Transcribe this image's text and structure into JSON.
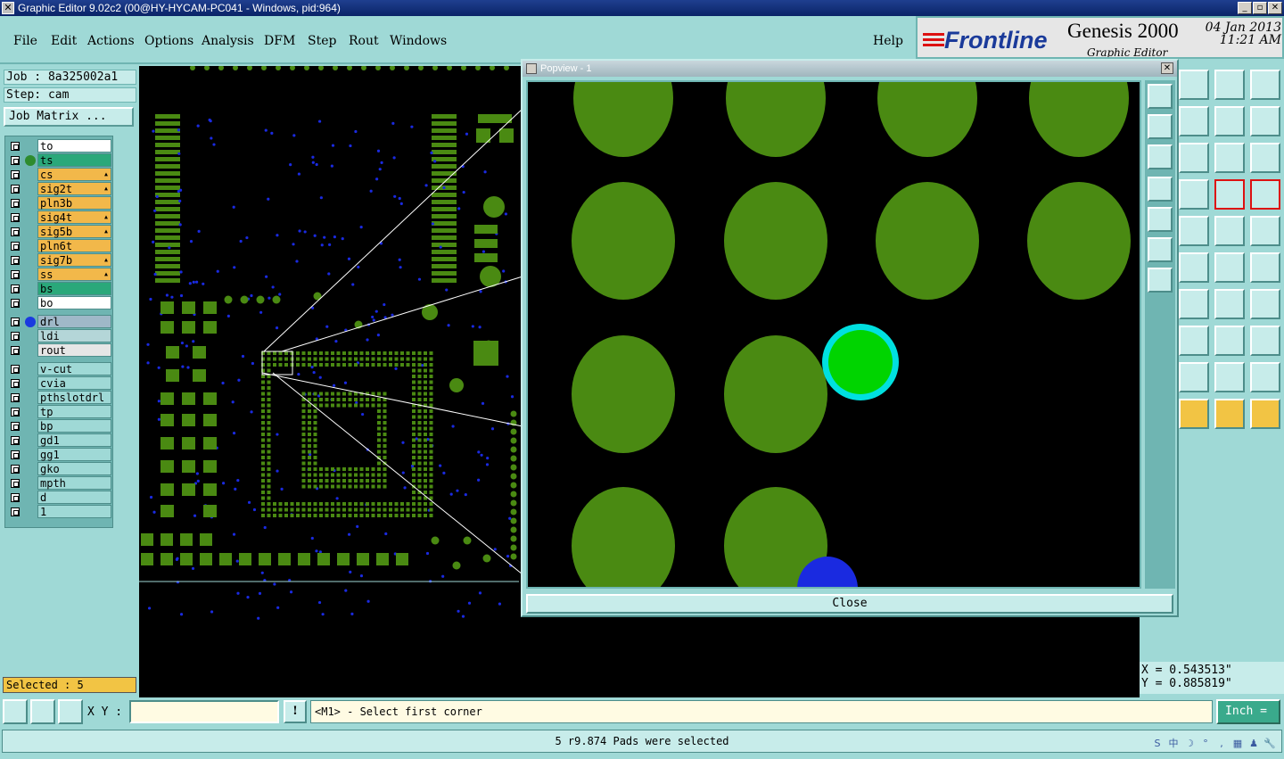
{
  "window": {
    "title": "Graphic Editor 9.02c2 (00@HY-HYCAM-PC041 - Windows, pid:964)",
    "app_icon": "x-icon",
    "controls": [
      "_",
      "▫",
      "X"
    ]
  },
  "menu": {
    "items": [
      "File",
      "Edit",
      "Actions",
      "Options",
      "Analysis",
      "DFM",
      "Step",
      "Rout",
      "Windows"
    ],
    "help": "Help"
  },
  "brand": {
    "logo": "Frontline",
    "product": "Genesis 2000",
    "subtitle": "Graphic Editor",
    "date": "04 Jan 2013",
    "time": "11:21 AM"
  },
  "job": {
    "job_line": "Job : 8a325002a1",
    "step_line": "Step: cam",
    "matrix_button": "Job Matrix ..."
  },
  "layers": {
    "board": [
      {
        "name": "to",
        "color": "#ffffff",
        "flag": ""
      },
      {
        "name": "ts",
        "color": "#2aa87a",
        "flag": "",
        "dot": "#2e8b2e"
      },
      {
        "name": "cs",
        "color": "#f2b84a",
        "flag": "▴"
      },
      {
        "name": "sig2t",
        "color": "#f2b84a",
        "flag": "▴"
      },
      {
        "name": "pln3b",
        "color": "#f2b84a",
        "flag": ""
      },
      {
        "name": "sig4t",
        "color": "#f2b84a",
        "flag": "▴"
      },
      {
        "name": "sig5b",
        "color": "#f2b84a",
        "flag": "▴"
      },
      {
        "name": "pln6t",
        "color": "#f2b84a",
        "flag": ""
      },
      {
        "name": "sig7b",
        "color": "#f2b84a",
        "flag": "▴"
      },
      {
        "name": "ss",
        "color": "#f2b84a",
        "flag": "▴"
      },
      {
        "name": "bs",
        "color": "#2aa87a",
        "flag": ""
      },
      {
        "name": "bo",
        "color": "#ffffff",
        "flag": ""
      }
    ],
    "drill": [
      {
        "name": "drl",
        "color": "#9fb8c8",
        "dot": "#1a3ae0"
      },
      {
        "name": "ldi",
        "color": "#b4d6d8"
      },
      {
        "name": "rout",
        "color": "#e6e6e6"
      }
    ],
    "misc": [
      {
        "name": "v-cut"
      },
      {
        "name": "cvia"
      },
      {
        "name": "pthslotdrl"
      },
      {
        "name": "tp"
      },
      {
        "name": "bp"
      },
      {
        "name": "gd1"
      },
      {
        "name": "gg1"
      },
      {
        "name": "gko"
      },
      {
        "name": "mpth"
      },
      {
        "name": "d"
      },
      {
        "name": "1"
      }
    ]
  },
  "selection": {
    "label": "Selected : 5"
  },
  "popview": {
    "title": "Popview - 1",
    "close_label": "Close",
    "pad_color": "#4a8a12",
    "highlight_color": "#00d400",
    "highlight_ring": "#00e0e0",
    "drill_color": "#1a2ae0"
  },
  "coords": {
    "x": "X = 0.543513\"",
    "y": "Y = 0.885819\""
  },
  "bottom": {
    "xy_label": "X Y :",
    "xy_value": "",
    "excl": "!",
    "prompt": "<M1> - Select first corner",
    "units": "Inch =",
    "status": "5 r9.874 Pads were selected"
  },
  "tray": [
    "S",
    "中",
    "☽",
    "°",
    ",",
    "▦",
    "♟",
    "🔧"
  ]
}
